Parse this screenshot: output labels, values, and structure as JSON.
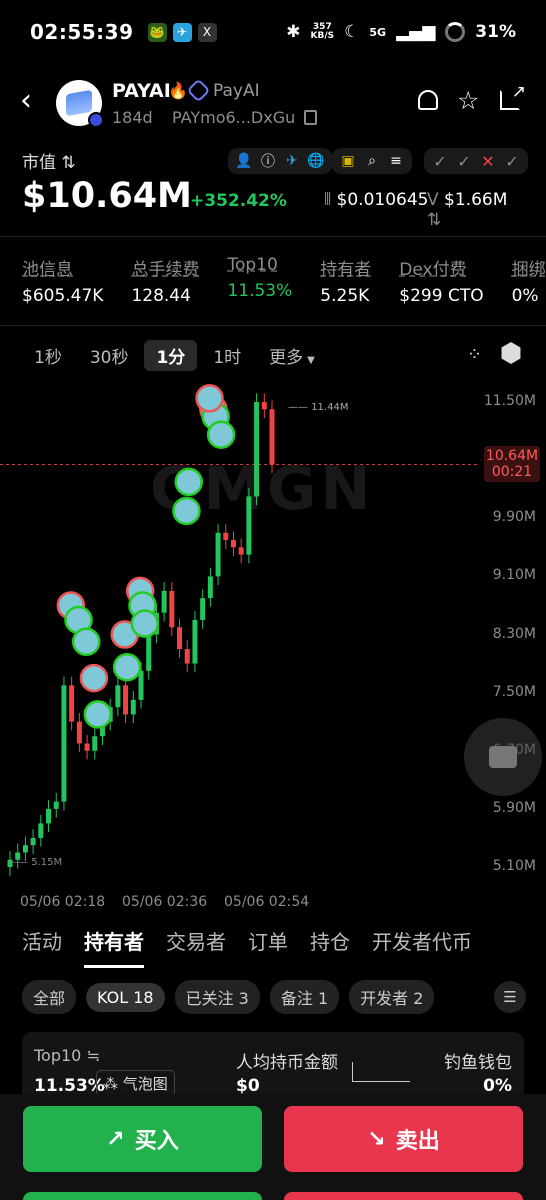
{
  "status_bar": {
    "time": "02:55:39",
    "net_speed": "357",
    "net_unit": "KB/S",
    "network": "5G",
    "battery": "31%"
  },
  "header": {
    "symbol": "PAYAI",
    "name": "PayAI",
    "age": "184d",
    "address": "PAYmo6...DxGu"
  },
  "market": {
    "label": "市值",
    "market_cap": "$10.64M",
    "change": "+352.42%",
    "price": "$0.010645",
    "volume": "$1.66M"
  },
  "stats": [
    {
      "label": "池信息",
      "value": "$605.47K",
      "color": "white"
    },
    {
      "label": "总手续费",
      "value": "128.44",
      "color": "white"
    },
    {
      "label": "Top10",
      "value": "11.53%",
      "color": "green"
    },
    {
      "label": "持有者",
      "value": "5.25K",
      "color": "white"
    },
    {
      "label": "Dex付费",
      "value": "$299 CTO",
      "color": "white"
    },
    {
      "label": "捆绑",
      "value": "0%",
      "color": "white"
    }
  ],
  "timeframes": [
    "1秒",
    "30秒",
    "1分",
    "1时",
    "更多"
  ],
  "active_timeframe": "1分",
  "chart": {
    "y_ticks": [
      "11.50M",
      "10.64M",
      "9.90M",
      "9.10M",
      "8.30M",
      "7.50M",
      "6.70M",
      "5.90M",
      "5.10M"
    ],
    "current_label": "10.64M",
    "countdown": "00:21",
    "max_label": "11.44M",
    "min_label": "5.15M",
    "watermark": "GMGN",
    "x_ticks": [
      "05/06 02:18",
      "05/06 02:36",
      "05/06 02:54"
    ]
  },
  "chart_data": {
    "type": "candlestick",
    "ylim": [
      5.0,
      11.8
    ],
    "ylabel": "",
    "xlabel": "",
    "values": [
      5.2,
      5.3,
      5.4,
      5.5,
      5.7,
      5.9,
      6.0,
      7.6,
      7.1,
      6.8,
      6.7,
      6.9,
      7.1,
      7.3,
      7.6,
      7.2,
      7.4,
      7.8,
      8.3,
      8.6,
      8.9,
      8.4,
      8.1,
      7.9,
      8.5,
      8.8,
      9.1,
      9.7,
      9.6,
      9.5,
      9.4,
      10.2,
      11.5,
      11.4,
      10.64
    ]
  },
  "tabs": [
    "活动",
    "持有者",
    "交易者",
    "订单",
    "持仓",
    "开发者代币"
  ],
  "active_tab": "持有者",
  "filters": [
    "全部",
    "KOL 18",
    "已关注 3",
    "备注 1",
    "开发者 2"
  ],
  "active_filter": "KOL 18",
  "holders": {
    "top10_label": "Top10",
    "top10_value": "11.53%",
    "bubble_label": "气泡图",
    "avg_label": "人均持币金额",
    "avg_value": "$0",
    "fish_label": "钓鱼钱包",
    "fish_value": "0%"
  },
  "actions": {
    "buy": "买入",
    "sell": "卖出"
  }
}
